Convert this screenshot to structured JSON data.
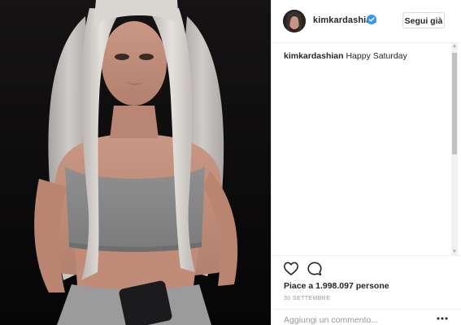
{
  "post": {
    "image_alt": "Foto del post",
    "header": {
      "username": "kimkardashian",
      "verified_icon": "verified-badge-icon",
      "follow_label": "Segui già"
    },
    "caption": {
      "username": "kimkardashian",
      "text": "Happy Saturday"
    },
    "actions": {
      "like_icon": "heart-outline-icon",
      "comment_icon": "speech-bubble-icon"
    },
    "likes_text": "Piace a 1.998.097 persone",
    "date": "30 SETTEMBRE",
    "comment_box": {
      "placeholder": "Aggiungi un commento...",
      "more_icon": "more-horizontal-icon"
    }
  },
  "colors": {
    "verified_blue": "#3897f0",
    "text_primary": "#262626",
    "text_secondary": "#999999",
    "border": "#efefef",
    "photo_background": "#0d0c0d"
  }
}
